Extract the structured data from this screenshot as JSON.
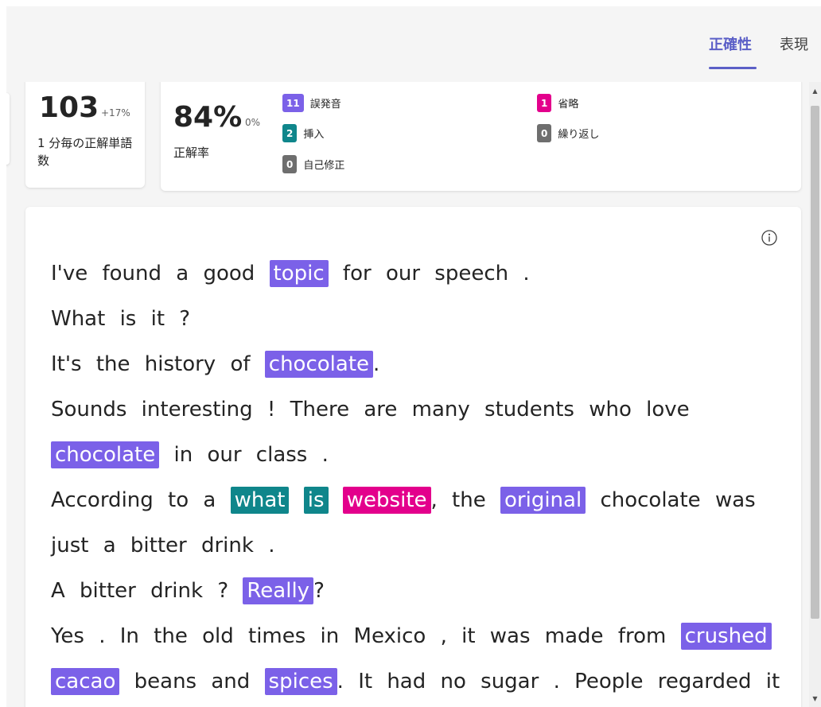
{
  "tabs": [
    {
      "label": "正確性",
      "active": true
    },
    {
      "label": "表現",
      "active": false
    }
  ],
  "wpm": {
    "value": "103",
    "delta": "+17%",
    "label": "1 分毎の正解単語数"
  },
  "accuracy": {
    "value": "84%",
    "delta": "0%",
    "label": "正解率"
  },
  "errors": [
    {
      "count": "11",
      "label": "誤発音",
      "color": "#7b61e8"
    },
    {
      "count": "2",
      "label": "挿入",
      "color": "#0f868b"
    },
    {
      "count": "0",
      "label": "自己修正",
      "color": "#6e6e6e"
    },
    {
      "count": "1",
      "label": "省略",
      "color": "#e3008c"
    },
    {
      "count": "0",
      "label": "繰り返し",
      "color": "#6e6e6e"
    }
  ],
  "colors": {
    "accent": "#5b5fc7",
    "mispronunciation": "#7b61e8",
    "insertion": "#0f868b",
    "omission": "#e3008c",
    "neutral": "#6e6e6e"
  },
  "info_icon": "info-icon",
  "passage": [
    [
      {
        "t": "I've found a good "
      },
      {
        "t": "topic",
        "hl": "mis"
      },
      {
        "t": " for our speech ."
      }
    ],
    [
      {
        "t": "What is it ?"
      }
    ],
    [
      {
        "t": "It's the history of "
      },
      {
        "t": "chocolate",
        "hl": "mis"
      },
      {
        "t": "."
      }
    ],
    [
      {
        "t": "Sounds interesting ! There are many students who love"
      }
    ],
    [
      {
        "t": "chocolate",
        "hl": "mis"
      },
      {
        "t": " in our class ."
      }
    ],
    [
      {
        "t": "According to a "
      },
      {
        "t": "what",
        "hl": "ins"
      },
      {
        "t": " "
      },
      {
        "t": "is",
        "hl": "ins"
      },
      {
        "t": " "
      },
      {
        "t": "website",
        "hl": "omi"
      },
      {
        "t": ", the "
      },
      {
        "t": "original",
        "hl": "mis"
      },
      {
        "t": " chocolate was"
      }
    ],
    [
      {
        "t": "just a bitter drink ."
      }
    ],
    [
      {
        "t": "A bitter drink ? "
      },
      {
        "t": "Really",
        "hl": "mis"
      },
      {
        "t": "?"
      }
    ],
    [
      {
        "t": "Yes . In the old times in Mexico , it was made from "
      },
      {
        "t": "crushed",
        "hl": "mis"
      }
    ],
    [
      {
        "t": "cacao",
        "hl": "mis"
      },
      {
        "t": " beans and "
      },
      {
        "t": "spices",
        "hl": "mis"
      },
      {
        "t": ". It had no sugar . People regarded it"
      }
    ]
  ]
}
